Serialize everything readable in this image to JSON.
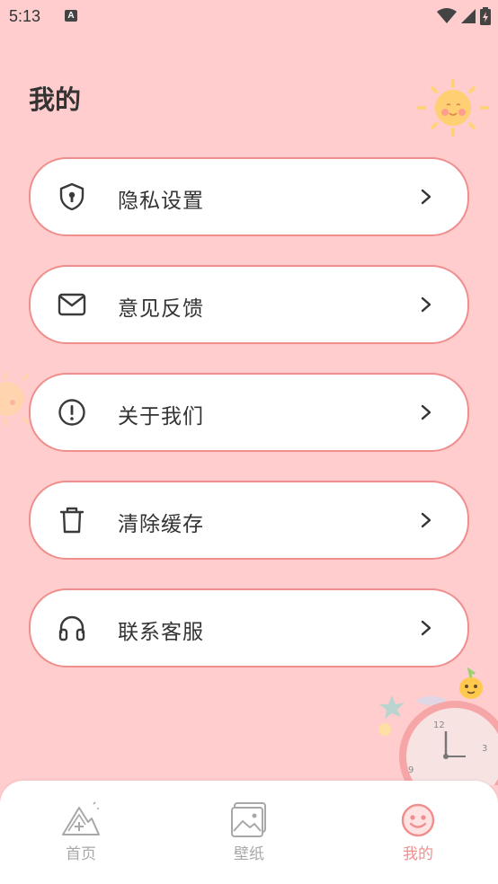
{
  "status": {
    "time": "5:13",
    "notif_letter": "A"
  },
  "page": {
    "title": "我的"
  },
  "menu": [
    {
      "label": "隐私设置",
      "icon": "shield-icon"
    },
    {
      "label": "意见反馈",
      "icon": "mail-icon"
    },
    {
      "label": "关于我们",
      "icon": "info-circle-icon"
    },
    {
      "label": "清除缓存",
      "icon": "trash-icon"
    },
    {
      "label": "联系客服",
      "icon": "headphones-icon"
    }
  ],
  "tabbar": {
    "items": [
      {
        "label": "首页",
        "icon": "mountain-icon",
        "active": false
      },
      {
        "label": "壁纸",
        "icon": "image-icon",
        "active": false
      },
      {
        "label": "我的",
        "icon": "smiley-icon",
        "active": true
      }
    ]
  },
  "colors": {
    "background": "#ffcdce",
    "accent": "#f08e8e",
    "card": "#ffffff",
    "tab_inactive": "#a8a8a8"
  }
}
